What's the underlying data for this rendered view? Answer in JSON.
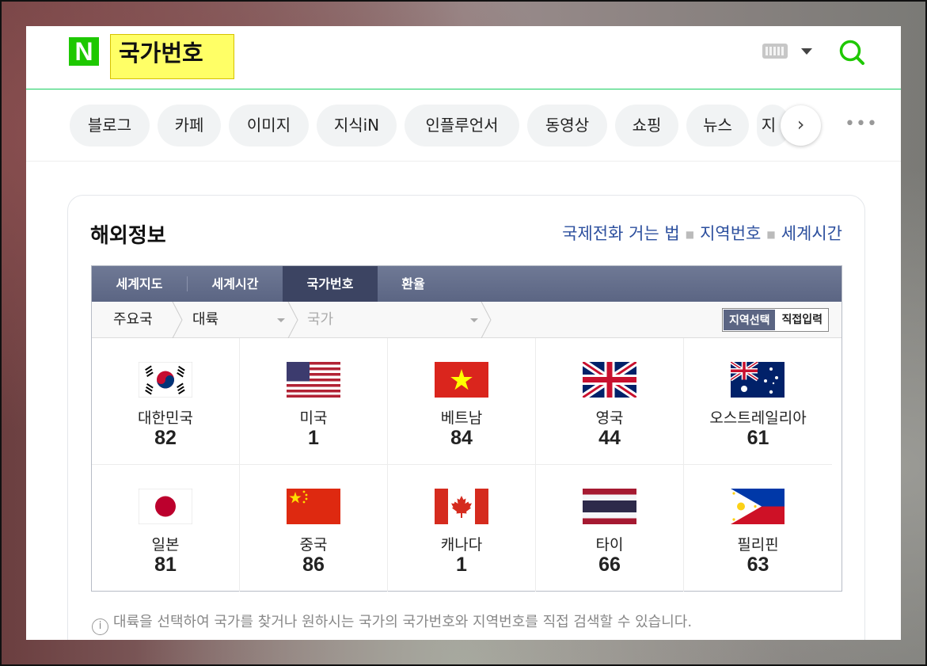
{
  "header": {
    "logo": "N",
    "query": "국가번호"
  },
  "tabs": [
    {
      "label": "블로그"
    },
    {
      "label": "카페"
    },
    {
      "label": "이미지"
    },
    {
      "label": "지식iN"
    },
    {
      "label": "인플루언서"
    },
    {
      "label": "동영상"
    },
    {
      "label": "쇼핑"
    },
    {
      "label": "뉴스"
    },
    {
      "label": "지"
    }
  ],
  "card": {
    "title": "해외정보",
    "links": [
      "국제전화 거는 법",
      "지역번호",
      "세계시간"
    ]
  },
  "widget": {
    "tabs": [
      "세계지도",
      "세계시간",
      "국가번호",
      "환율"
    ],
    "active_tab": "국가번호",
    "crumbs": {
      "home": "주요국",
      "continent": "대륙",
      "country": "국가"
    },
    "segments": [
      "지역선택",
      "직접입력"
    ],
    "countries": [
      {
        "name": "대한민국",
        "code": "82"
      },
      {
        "name": "미국",
        "code": "1"
      },
      {
        "name": "베트남",
        "code": "84"
      },
      {
        "name": "영국",
        "code": "44"
      },
      {
        "name": "오스트레일리아",
        "code": "61"
      },
      {
        "name": "일본",
        "code": "81"
      },
      {
        "name": "중국",
        "code": "86"
      },
      {
        "name": "캐나다",
        "code": "1"
      },
      {
        "name": "타이",
        "code": "66"
      },
      {
        "name": "필리핀",
        "code": "63"
      }
    ]
  },
  "note": "대륙을 선택하여 국가를 찾거나 원하시는 국가의 국가번호와 지역번호를 직접 검색할 수 있습니다.",
  "colors": {
    "brand_green": "#1ec800",
    "highlight": "#ffff66",
    "link_blue": "#2c4f9e",
    "widget_nav": "#5b6583"
  }
}
